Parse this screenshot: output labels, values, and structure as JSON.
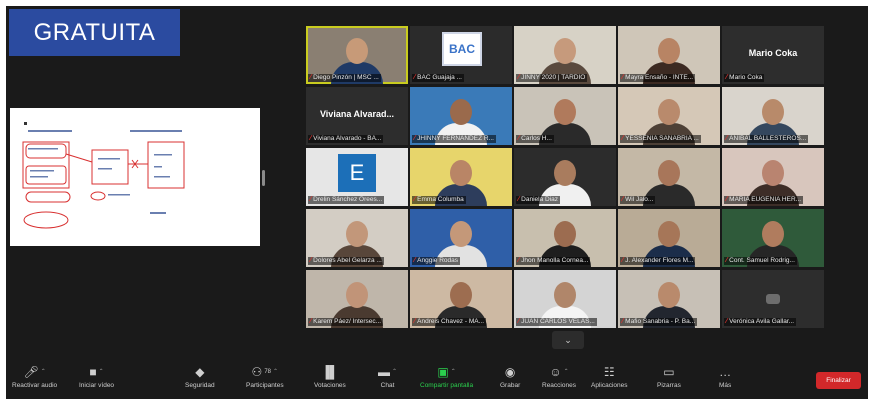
{
  "banner": {
    "text": "GRATUITA"
  },
  "participants": [
    {
      "name": "Diego Pinzón | MSC ...",
      "kind": "video",
      "bg": "#8a7f72",
      "skin": "#c79a78",
      "shirt": "#1f3a66",
      "active": true
    },
    {
      "name": "BAC Guajaja ...",
      "kind": "logo-bac",
      "logo": "BAC",
      "bg": "#2b2b2b"
    },
    {
      "name": "JINNY 2020 | TARDIO",
      "kind": "video",
      "bg": "#d7d2c6",
      "skin": "#c69a7c",
      "shirt": "#5a4a3e"
    },
    {
      "name": "Mayra Ensaño - INTE...",
      "kind": "video",
      "bg": "#cfc6b8",
      "skin": "#b88464",
      "shirt": "#3c2a22"
    },
    {
      "name": "Mario Coka",
      "kind": "name",
      "big_name": "Mario Coka",
      "bg": "#2d2d2d"
    },
    {
      "name": "Viviana Alvarado - BA...",
      "kind": "name",
      "big_name": "Viviana Alvarad...",
      "bg": "#2d2d2d"
    },
    {
      "name": "JHINNY FERNANDEZ R...",
      "kind": "video",
      "bg": "#3a7ab8",
      "skin": "#9a6a4c",
      "shirt": "#f2f2f2"
    },
    {
      "name": "Carlos H...",
      "kind": "video",
      "bg": "#c9c3b8",
      "skin": "#b07a5c",
      "shirt": "#2a2a2a"
    },
    {
      "name": "YESSENIA SANABRIA ...",
      "kind": "video",
      "bg": "#d5c8b7",
      "skin": "#b98a6c",
      "shirt": "#4d4036"
    },
    {
      "name": "ANIBAL BALLESTEROS...",
      "kind": "video",
      "bg": "#d9d4cc",
      "skin": "#b88a6a",
      "shirt": "#34475e"
    },
    {
      "name": "Drelin Sánchez Orees...",
      "kind": "logo-e",
      "logo": "E",
      "bg": "#e6e6e6"
    },
    {
      "name": "Emma Columba",
      "kind": "video",
      "bg": "#e7d56b",
      "skin": "#b98566",
      "shirt": "#2d3d5c"
    },
    {
      "name": "Daniela Diaz",
      "kind": "video",
      "bg": "#2c2c2c",
      "skin": "#a97c5e",
      "shirt": "#f0f0f0"
    },
    {
      "name": "Wil Jalo...",
      "kind": "video",
      "bg": "#c4b8a6",
      "skin": "#a8765a",
      "shirt": "#2a2a2a"
    },
    {
      "name": "MARIA EUGENIA HER...",
      "kind": "video",
      "bg": "#d8c6bd",
      "skin": "#b98470",
      "shirt": "#3d2d27"
    },
    {
      "name": "Dolores Abel Gelarza ...",
      "kind": "video",
      "bg": "#d3cdc4",
      "skin": "#c2977a",
      "shirt": "#58463a"
    },
    {
      "name": "Anggie Rodas",
      "kind": "video",
      "bg": "#2f5fa8",
      "skin": "#c49879",
      "shirt": "#e2e2e2"
    },
    {
      "name": "Jhon Manolla Cornea...",
      "kind": "video",
      "bg": "#c8bfae",
      "skin": "#9c6c50",
      "shirt": "#1e1e1e"
    },
    {
      "name": "J. Alexander Flores M...",
      "kind": "video",
      "bg": "#b9ab96",
      "skin": "#a67658",
      "shirt": "#1b2d4a"
    },
    {
      "name": "Cont. Samuel Rodrig...",
      "kind": "video",
      "bg": "#2f5a3a",
      "skin": "#b07c5e",
      "shirt": "#262626"
    },
    {
      "name": "Karem Páez/ Intersec...",
      "kind": "video",
      "bg": "#bfb6aa",
      "skin": "#c19478",
      "shirt": "#4a3a30"
    },
    {
      "name": "Andreis Chavez - MA...",
      "kind": "video",
      "bg": "#cdb9a3",
      "skin": "#9d6d50",
      "shirt": "#2a2a2a"
    },
    {
      "name": "JUAN CARLOS VELAS...",
      "kind": "video",
      "bg": "#d4d4d4",
      "skin": "#b0866a",
      "shirt": "#f4f4f4"
    },
    {
      "name": "Mafio Sanabria - P. Ba...",
      "kind": "video",
      "bg": "#c7c0b6",
      "skin": "#b98a6c",
      "shirt": "#22262f"
    },
    {
      "name": "Verónica Avila Gallar...",
      "kind": "camoff",
      "bg": "#2d2d2d"
    }
  ],
  "toolbar": {
    "mute": "Reactivar audio",
    "video": "Iniciar vídeo",
    "security": "Seguridad",
    "participants": "Participantes",
    "participants_count": "78",
    "polls": "Votaciones",
    "chat": "Chat",
    "share": "Compartir pantalla",
    "record": "Grabar",
    "reactions": "Reacciones",
    "apps": "Aplicaciones",
    "whiteboards": "Pizarras",
    "more": "Más",
    "end": "Finalizar"
  },
  "icons": {
    "mute": "mic-off-icon",
    "video": "video-off-icon",
    "security": "shield-icon",
    "participants": "people-icon",
    "polls": "bar-chart-icon",
    "chat": "chat-bubble-icon",
    "share": "share-screen-icon",
    "record": "record-icon",
    "reactions": "smiley-icon",
    "apps": "apps-icon",
    "whiteboards": "whiteboard-icon",
    "more": "more-dots-icon",
    "gallery_toggle": "chevron-down-icon"
  },
  "colors": {
    "banner": "#2b4ba0",
    "active_speaker": "#c9cc1f",
    "share_green": "#2bd14e",
    "end_red": "#d2282a",
    "muted_red": "#e0332f"
  }
}
